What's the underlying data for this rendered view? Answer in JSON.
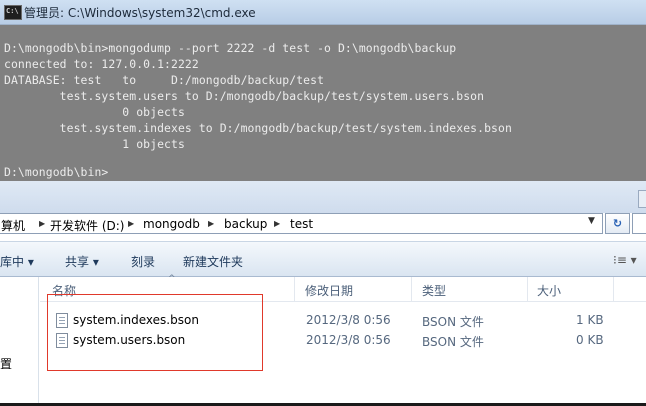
{
  "cmd": {
    "title": "管理员: C:\\Windows\\system32\\cmd.exe",
    "lines": [
      "D:\\mongodb\\bin>mongodump --port 2222 -d test -o D:\\mongodb\\backup",
      "connected to: 127.0.0.1:2222",
      "DATABASE: test   to     D:/mongodb/backup/test",
      "        test.system.users to D:/mongodb/backup/test/system.users.bson",
      "                 0 objects",
      "        test.system.indexes to D:/mongodb/backup/test/system.indexes.bson",
      "                 1 objects",
      "",
      "D:\\mongodb\\bin>"
    ]
  },
  "explorer": {
    "breadcrumb": [
      "算机",
      "开发软件 (D:)",
      "mongodb",
      "backup",
      "test"
    ],
    "toolbar": {
      "include": "库中 ▾",
      "share": "共享 ▾",
      "burn": "刻录",
      "new_folder": "新建文件夹",
      "view": "⁝≡ ▾"
    },
    "nav": {
      "item": "置"
    },
    "columns": {
      "name": "名称",
      "date": "修改日期",
      "type": "类型",
      "size": "大小"
    },
    "files": [
      {
        "name": "system.indexes.bson",
        "date": "2012/3/8 0:56",
        "type": "BSON 文件",
        "size": "1 KB"
      },
      {
        "name": "system.users.bson",
        "date": "2012/3/8 0:56",
        "type": "BSON 文件",
        "size": "0 KB"
      }
    ]
  },
  "colors": {
    "console_bg": "#808080",
    "console_text": "#ececec",
    "highlight": "#e0392b"
  }
}
